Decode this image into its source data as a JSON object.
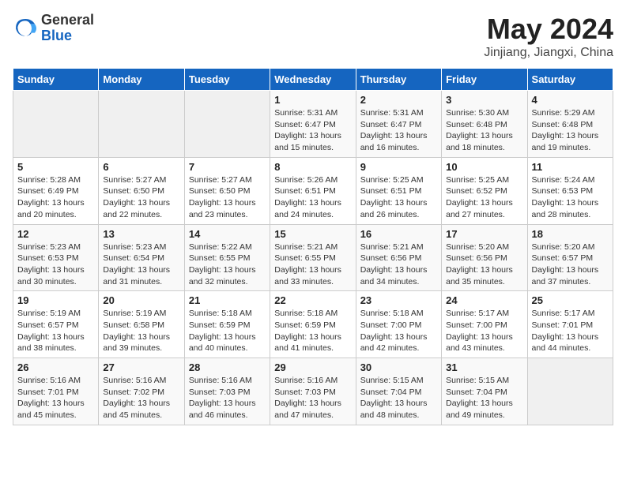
{
  "logo": {
    "general": "General",
    "blue": "Blue"
  },
  "title": "May 2024",
  "subtitle": "Jinjiang, Jiangxi, China",
  "weekdays": [
    "Sunday",
    "Monday",
    "Tuesday",
    "Wednesday",
    "Thursday",
    "Friday",
    "Saturday"
  ],
  "weeks": [
    [
      {
        "day": "",
        "info": ""
      },
      {
        "day": "",
        "info": ""
      },
      {
        "day": "",
        "info": ""
      },
      {
        "day": "1",
        "info": "Sunrise: 5:31 AM\nSunset: 6:47 PM\nDaylight: 13 hours and 15 minutes."
      },
      {
        "day": "2",
        "info": "Sunrise: 5:31 AM\nSunset: 6:47 PM\nDaylight: 13 hours and 16 minutes."
      },
      {
        "day": "3",
        "info": "Sunrise: 5:30 AM\nSunset: 6:48 PM\nDaylight: 13 hours and 18 minutes."
      },
      {
        "day": "4",
        "info": "Sunrise: 5:29 AM\nSunset: 6:48 PM\nDaylight: 13 hours and 19 minutes."
      }
    ],
    [
      {
        "day": "5",
        "info": "Sunrise: 5:28 AM\nSunset: 6:49 PM\nDaylight: 13 hours and 20 minutes."
      },
      {
        "day": "6",
        "info": "Sunrise: 5:27 AM\nSunset: 6:50 PM\nDaylight: 13 hours and 22 minutes."
      },
      {
        "day": "7",
        "info": "Sunrise: 5:27 AM\nSunset: 6:50 PM\nDaylight: 13 hours and 23 minutes."
      },
      {
        "day": "8",
        "info": "Sunrise: 5:26 AM\nSunset: 6:51 PM\nDaylight: 13 hours and 24 minutes."
      },
      {
        "day": "9",
        "info": "Sunrise: 5:25 AM\nSunset: 6:51 PM\nDaylight: 13 hours and 26 minutes."
      },
      {
        "day": "10",
        "info": "Sunrise: 5:25 AM\nSunset: 6:52 PM\nDaylight: 13 hours and 27 minutes."
      },
      {
        "day": "11",
        "info": "Sunrise: 5:24 AM\nSunset: 6:53 PM\nDaylight: 13 hours and 28 minutes."
      }
    ],
    [
      {
        "day": "12",
        "info": "Sunrise: 5:23 AM\nSunset: 6:53 PM\nDaylight: 13 hours and 30 minutes."
      },
      {
        "day": "13",
        "info": "Sunrise: 5:23 AM\nSunset: 6:54 PM\nDaylight: 13 hours and 31 minutes."
      },
      {
        "day": "14",
        "info": "Sunrise: 5:22 AM\nSunset: 6:55 PM\nDaylight: 13 hours and 32 minutes."
      },
      {
        "day": "15",
        "info": "Sunrise: 5:21 AM\nSunset: 6:55 PM\nDaylight: 13 hours and 33 minutes."
      },
      {
        "day": "16",
        "info": "Sunrise: 5:21 AM\nSunset: 6:56 PM\nDaylight: 13 hours and 34 minutes."
      },
      {
        "day": "17",
        "info": "Sunrise: 5:20 AM\nSunset: 6:56 PM\nDaylight: 13 hours and 35 minutes."
      },
      {
        "day": "18",
        "info": "Sunrise: 5:20 AM\nSunset: 6:57 PM\nDaylight: 13 hours and 37 minutes."
      }
    ],
    [
      {
        "day": "19",
        "info": "Sunrise: 5:19 AM\nSunset: 6:57 PM\nDaylight: 13 hours and 38 minutes."
      },
      {
        "day": "20",
        "info": "Sunrise: 5:19 AM\nSunset: 6:58 PM\nDaylight: 13 hours and 39 minutes."
      },
      {
        "day": "21",
        "info": "Sunrise: 5:18 AM\nSunset: 6:59 PM\nDaylight: 13 hours and 40 minutes."
      },
      {
        "day": "22",
        "info": "Sunrise: 5:18 AM\nSunset: 6:59 PM\nDaylight: 13 hours and 41 minutes."
      },
      {
        "day": "23",
        "info": "Sunrise: 5:18 AM\nSunset: 7:00 PM\nDaylight: 13 hours and 42 minutes."
      },
      {
        "day": "24",
        "info": "Sunrise: 5:17 AM\nSunset: 7:00 PM\nDaylight: 13 hours and 43 minutes."
      },
      {
        "day": "25",
        "info": "Sunrise: 5:17 AM\nSunset: 7:01 PM\nDaylight: 13 hours and 44 minutes."
      }
    ],
    [
      {
        "day": "26",
        "info": "Sunrise: 5:16 AM\nSunset: 7:01 PM\nDaylight: 13 hours and 45 minutes."
      },
      {
        "day": "27",
        "info": "Sunrise: 5:16 AM\nSunset: 7:02 PM\nDaylight: 13 hours and 45 minutes."
      },
      {
        "day": "28",
        "info": "Sunrise: 5:16 AM\nSunset: 7:03 PM\nDaylight: 13 hours and 46 minutes."
      },
      {
        "day": "29",
        "info": "Sunrise: 5:16 AM\nSunset: 7:03 PM\nDaylight: 13 hours and 47 minutes."
      },
      {
        "day": "30",
        "info": "Sunrise: 5:15 AM\nSunset: 7:04 PM\nDaylight: 13 hours and 48 minutes."
      },
      {
        "day": "31",
        "info": "Sunrise: 5:15 AM\nSunset: 7:04 PM\nDaylight: 13 hours and 49 minutes."
      },
      {
        "day": "",
        "info": ""
      }
    ]
  ]
}
